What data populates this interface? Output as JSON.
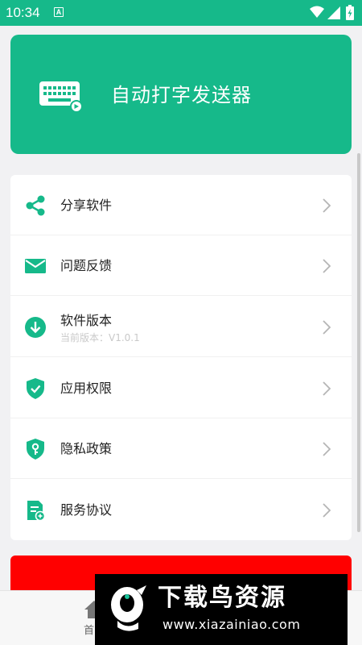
{
  "status_bar": {
    "time": "10:34",
    "notification_letter": "A",
    "icons": [
      "wifi-icon",
      "signal-icon",
      "battery-charging-icon"
    ]
  },
  "header": {
    "title": "自动打字发送器",
    "icon": "keyboard-icon"
  },
  "menu": {
    "items": [
      {
        "label": "分享软件",
        "icon": "share-icon"
      },
      {
        "label": "问题反馈",
        "icon": "mail-icon"
      },
      {
        "label": "软件版本",
        "sub": "当前版本：V1.0.1",
        "icon": "download-icon"
      },
      {
        "label": "应用权限",
        "icon": "shield-check-icon"
      },
      {
        "label": "隐私政策",
        "icon": "privacy-key-icon"
      },
      {
        "label": "服务协议",
        "icon": "agreement-doc-icon"
      }
    ]
  },
  "bottom_nav": {
    "home_label": "首",
    "icon": "home-icon"
  },
  "watermark": {
    "brand": "下载鸟资源",
    "url": "www.xiazainiao.com"
  },
  "colors": {
    "primary": "#16b98a",
    "banner": "#ff0000",
    "background": "#f1f1f3"
  }
}
